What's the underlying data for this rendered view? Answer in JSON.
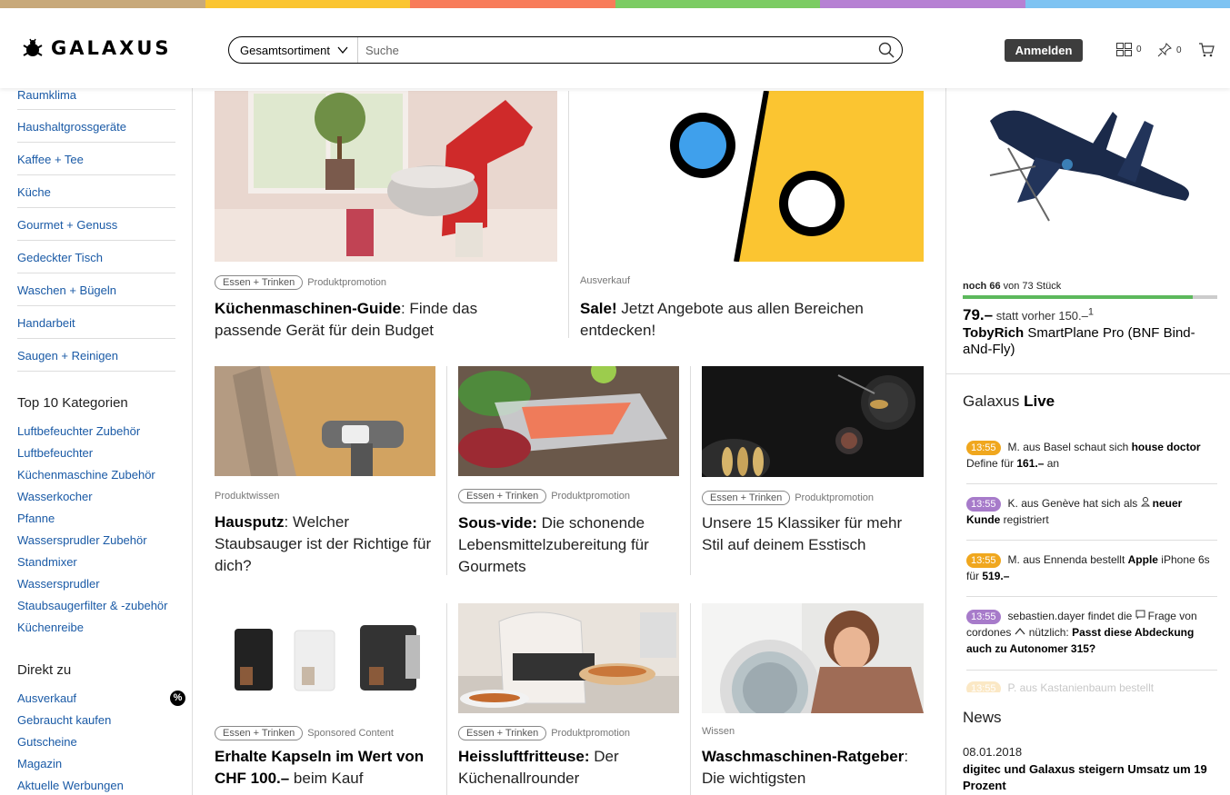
{
  "color_strip": [
    "#c8a97a",
    "#fbc531",
    "#f87c5a",
    "#7ccc63",
    "#b681d3",
    "#7ec3f2"
  ],
  "header": {
    "logo_text": "GALAXUS",
    "search_category": "Gesamtsortiment",
    "search_placeholder": "Suche",
    "login_label": "Anmelden",
    "compare_count": "0",
    "watchlist_count": "0"
  },
  "sidebar": {
    "categories": [
      "Raumklima",
      "Haushaltgrossgeräte",
      "Kaffee + Tee",
      "Küche",
      "Gourmet + Genuss",
      "Gedeckter Tisch",
      "Waschen + Bügeln",
      "Handarbeit",
      "Saugen + Reinigen"
    ],
    "top10_heading": "Top 10 Kategorien",
    "top10": [
      "Luftbefeuchter Zubehör",
      "Luftbefeuchter",
      "Küchenmaschine Zubehör",
      "Wasserkocher",
      "Pfanne",
      "Wassersprudler Zubehör",
      "Standmixer",
      "Wassersprudler",
      "Staubsaugerfilter & -zubehör",
      "Küchenreibe"
    ],
    "direct_heading": "Direkt zu",
    "direct": [
      "Ausverkauf",
      "Gebraucht kaufen",
      "Gutscheine",
      "Magazin",
      "Aktuelle Werbungen"
    ],
    "sale_badge": "%"
  },
  "cards": [
    {
      "tag": "Essen + Trinken",
      "type": "Produktpromotion",
      "title_bold": "Küchenmaschinen-Guide",
      "title_rest": ": Finde das passende Gerät für dein Budget"
    },
    {
      "tag": "",
      "type": "Ausverkauf",
      "title_bold": "Sale!",
      "title_rest": " Jetzt Angebote aus allen Bereichen entdecken!"
    },
    {
      "tag": "",
      "type": "Produktwissen",
      "title_bold": "Hausputz",
      "title_rest": ": Welcher Staubsauger ist der Richtige für dich?"
    },
    {
      "tag": "Essen + Trinken",
      "type": "Produktpromotion",
      "title_bold": "Sous-vide:",
      "title_rest": " Die schonende Lebensmittelzubereitung für Gourmets"
    },
    {
      "tag": "Essen + Trinken",
      "type": "Produktpromotion",
      "title_bold": "",
      "title_rest": "Unsere 15 Klassiker für mehr Stil auf deinem Esstisch"
    },
    {
      "tag": "Essen + Trinken",
      "type": "Sponsored Content",
      "title_bold": "Erhalte Kapseln im Wert von CHF 100.–",
      "title_rest": " beim Kauf"
    },
    {
      "tag": "Essen + Trinken",
      "type": "Produktpromotion",
      "title_bold": "Heissluftfritteuse:",
      "title_rest": " Der Küchenallrounder"
    },
    {
      "tag": "",
      "type": "Wissen",
      "title_bold": "Waschmaschinen-Ratgeber",
      "title_rest": ": Die wichtigsten"
    }
  ],
  "deal": {
    "stock_bold": "noch 66",
    "stock_rest": " von 73 Stück",
    "stock_fraction": 0.904,
    "price": "79.–",
    "previous": " statt vorher 150.–",
    "footnote": "1",
    "brand": "TobyRich",
    "product": " SmartPlane Pro (BNF Bind-aNd-Fly)"
  },
  "live": {
    "heading_plain": "Galaxus ",
    "heading_bold": "Live",
    "items": [
      {
        "time": "13:55",
        "color": "#f0a71e",
        "text": "M. aus Basel schaut sich ",
        "bold": "house doctor",
        "rest": " Define für ",
        "bold2": "161.–",
        "rest2": " an"
      },
      {
        "time": "13:55",
        "color": "#a77bca",
        "text": "K. aus Genève hat sich als ",
        "bold": "neuer Kunde",
        "rest": " registriert",
        "bold2": "",
        "rest2": ""
      },
      {
        "time": "13:55",
        "color": "#f0a71e",
        "text": "M. aus Ennenda bestellt ",
        "bold": "Apple",
        "rest": " iPhone 6s für ",
        "bold2": "519.–",
        "rest2": ""
      },
      {
        "time": "13:55",
        "color": "#a77bca",
        "text": "sebastien.dayer findet die ",
        "bold": "",
        "rest": "Frage von cordones ",
        "bold2": "Passt diese Abdeckung auch zu Autonomer 315?",
        "rest2": ""
      },
      {
        "time": "13:55",
        "color": "#f0a71e",
        "text": "P. aus Kastanienbaum bestellt",
        "bold": "",
        "rest": "",
        "bold2": "",
        "rest2": ""
      }
    ]
  },
  "news": {
    "heading": "News",
    "date": "08.01.2018",
    "title": "digitec und Galaxus steigern Umsatz um 19 Prozent"
  }
}
